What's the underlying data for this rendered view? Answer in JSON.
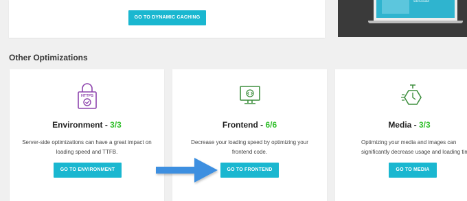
{
  "top": {
    "button_label": "GO TO DYNAMIC CACHING"
  },
  "promo": {
    "brand": "SiteGround"
  },
  "section_title": "Other Optimizations",
  "cards": [
    {
      "title": "Environment",
      "separator": " - ",
      "score": "3/3",
      "icon": "https-lock-icon",
      "description": "Server-side optimizations can have a great impact on loading speed and TTFB.",
      "button": "GO TO ENVIRONMENT"
    },
    {
      "title": "Frontend",
      "separator": " - ",
      "score": "6/6",
      "icon": "monitor-code-icon",
      "description": "Decrease your loading speed by optimizing your frontend code.",
      "button": "GO TO FRONTEND"
    },
    {
      "title": "Media",
      "separator": " - ",
      "score": "3/3",
      "icon": "stopwatch-icon",
      "description": "Optimizing your media and images can significantly decrease usage and loading tim",
      "button": "GO TO MEDIA"
    }
  ],
  "colors": {
    "accent": "#1ab7d0",
    "score": "#35c02f",
    "env_icon": "#8e44ad",
    "fe_icon": "#3f8f3f",
    "media_icon": "#3f8f3f",
    "arrow": "#3d8fe0"
  }
}
